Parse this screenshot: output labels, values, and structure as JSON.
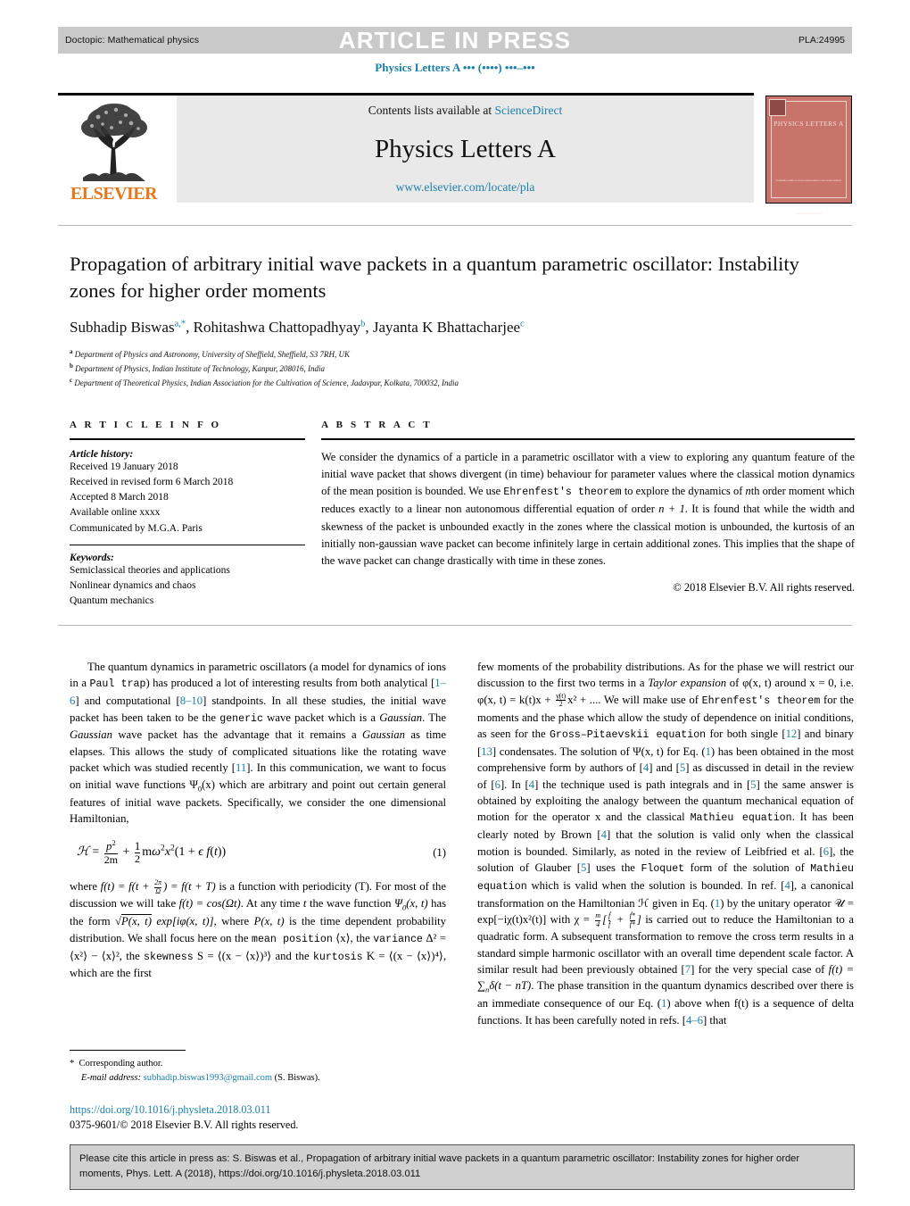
{
  "press_band": {
    "doctopic": "Doctopic: Mathematical physics",
    "title": "ARTICLE IN PRESS",
    "pla_code": "PLA:24995"
  },
  "running_head": "Physics Letters A ••• (••••) •••–•••",
  "masthead": {
    "contents_prefix": "Contents lists available at ",
    "sciencedirect": "ScienceDirect",
    "journal_name": "Physics Letters A",
    "journal_url": "www.elsevier.com/locate/pla",
    "publisher": "ELSEVIER"
  },
  "cover": {
    "title": "PHYSICS LETTERS A",
    "footer": "Available online at www.sciencedirect.com\nScienceDirect",
    "bottom": "An International Journal"
  },
  "article": {
    "title": "Propagation of arbitrary initial wave packets in a quantum parametric oscillator: Instability zones for higher order moments",
    "authors": [
      {
        "name": "Subhadip Biswas",
        "marks": "a,*"
      },
      {
        "name": "Rohitashwa Chattopadhyay",
        "marks": "b"
      },
      {
        "name": "Jayanta K Bhattacharjee",
        "marks": "c"
      }
    ],
    "affiliations": [
      {
        "mark": "a",
        "text": "Department of Physics and Astronomy, University of Sheffield, Sheffield, S3 7RH, UK"
      },
      {
        "mark": "b",
        "text": "Department of Physics, Indian Institute of Technology, Kanpur, 208016, India"
      },
      {
        "mark": "c",
        "text": "Department of Theoretical Physics, Indian Association for the Cultivation of Science, Jadavpur, Kolkata, 700032, India"
      }
    ]
  },
  "info": {
    "heading": "A R T I C L E   I N F O",
    "history_label": "Article history:",
    "history": [
      "Received 19 January 2018",
      "Received in revised form 6 March 2018",
      "Accepted 8 March 2018",
      "Available online xxxx",
      "Communicated by M.G.A. Paris"
    ],
    "keywords_label": "Keywords:",
    "keywords": [
      "Semiclassical theories and applications",
      "Nonlinear dynamics and chaos",
      "Quantum mechanics"
    ]
  },
  "abstract": {
    "heading": "A B S T R A C T",
    "part1": "We consider the dynamics of a particle in a parametric oscillator with a view to exploring any quantum feature of the initial wave packet that shows divergent (in time) behaviour for parameter values where the classical motion dynamics of the mean position is bounded. We use ",
    "mono1": "Ehrenfest's theorem",
    "part2": " to explore the dynamics of ",
    "italic_n": "n",
    "part3": "th order moment which reduces exactly to a linear non autonomous differential equation of order ",
    "order_math": "n + 1",
    "part4": ". It is found that while the width and skewness of the packet is unbounded exactly in the zones where the classical motion is unbounded, the kurtosis of an initially non-gaussian wave packet can become infinitely large in certain additional zones. This implies that the shape of the wave packet can change drastically with time in these zones.",
    "copyright": "© 2018 Elsevier B.V. All rights reserved."
  },
  "body": {
    "left": {
      "p1_a": "The quantum dynamics in parametric oscillators (a model for dynamics of ions in a ",
      "p1_mono1": "Paul trap",
      "p1_b": ") has produced a lot of interesting results from both analytical [",
      "p1_ref1": "1–6",
      "p1_c": "] and computational [",
      "p1_ref2": "8–10",
      "p1_d": "] standpoints. In all these studies, the initial wave packet has been taken to be the ",
      "p1_mono2": "generic",
      "p1_e": " wave packet which is a ",
      "p1_it1": "Gaussian",
      "p1_f": ". The ",
      "p1_it2": "Gaussian",
      "p1_g": " wave packet has the advantage that it remains a ",
      "p1_it3": "Gaussian",
      "p1_h": " as time elapses. This allows the study of complicated situations like the rotating wave packet which was studied recently [",
      "p1_ref3": "11",
      "p1_i": "]. In this communication, we want to focus on initial wave functions Ψ",
      "p1_sub": "0",
      "p1_j": "(x) which are arbitrary and point out certain general features of initial wave packets. Specifically, we consider the one dimensional Hamiltonian,",
      "eq1_number": "(1)",
      "p2_a": "where ",
      "p2_b": " is a function with periodicity (T). For most of the discussion we will take ",
      "p2_c": ". At any time ",
      "p2_d": " the wave function ",
      "p2_e": " has the form ",
      "p2_f": ", where ",
      "p2_g": " is the time dependent probability distribution. We shall focus here on the ",
      "p2_mono1": "mean position",
      "p2_h": " ⟨x⟩, the ",
      "p2_mono2": "variance",
      "p2_i": " Δ² = ⟨x²⟩ − ⟨x⟩², the ",
      "p2_mono3": "skewness",
      "p2_j": " S = ⟨(x − ⟨x⟩)³⟩ and the ",
      "p2_mono4": "kurtosis",
      "p2_k": " K = ⟨(x − ⟨x⟩)⁴⟩, which are the first"
    },
    "right": {
      "p3_a": "few moments of the probability distributions. As for the phase we will restrict our discussion to the first two terms in a ",
      "p3_it1": "Taylor expansion",
      "p3_b": " of φ(x, t) around x = 0, i.e. φ(x, t) = k(t)x + ",
      "p3_c": "x² + .... We will make use of ",
      "p3_mono1": "Ehrenfest's theorem",
      "p3_d": " for the moments and the phase which allow the study of dependence on initial conditions, as seen for the ",
      "p3_mono2": "Gross–Pitaevskii equation",
      "p3_e": " for both single [",
      "p3_ref1": "12",
      "p3_f": "] and binary [",
      "p3_ref2": "13",
      "p3_g": "] condensates. The solution of Ψ(x, t) for Eq. (",
      "p3_ref3": "1",
      "p3_h": ") has been obtained in the most comprehensive form by authors of [",
      "p3_ref4": "4",
      "p3_i": "] and [",
      "p3_ref5": "5",
      "p3_j": "] as discussed in detail in the review of [",
      "p3_ref6": "6",
      "p3_k": "]. In [",
      "p3_ref7": "4",
      "p3_l": "] the technique used is path integrals and in [",
      "p3_ref8": "5",
      "p3_m": "] the same answer is obtained by exploiting the analogy between the quantum mechanical equation of motion for the operator x and the classical ",
      "p3_mono3": "Mathieu equation",
      "p3_n": ". It has been clearly noted by Brown [",
      "p3_ref9": "4",
      "p3_o": "] that the solution is valid only when the classical motion is bounded. Similarly, as noted in the review of Leibfried et al. [",
      "p3_ref10": "6",
      "p3_p": "], the solution of Glauber [",
      "p3_ref11": "5",
      "p3_q": "] uses the ",
      "p3_mono4": "Floquet",
      "p3_r": " form of the solution of ",
      "p3_mono5": "Mathieu equation",
      "p3_s": " which is valid when the solution is bounded. In ref. [",
      "p3_ref12": "4",
      "p3_t": "], a canonical transformation on the Hamiltonian ℋ given in Eq. (",
      "p3_ref13": "1",
      "p3_u": ") by the unitary operator 𝒰 = exp[−iχ(t)x²(t)] with χ = ",
      "p3_v": " is carried out to reduce the Hamiltonian to a quadratic form. A subsequent transformation to remove the cross term results in a standard simple harmonic oscillator with an overall time dependent scale factor. A similar result had been previously obtained [",
      "p3_ref14": "7",
      "p3_w": "] for the very special case of ",
      "p3_x": ". The phase transition in the quantum dynamics described over there is an immediate consequence of our Eq. (",
      "p3_ref15": "1",
      "p3_y": ") above when f(t) is a sequence of delta functions. It has been carefully noted in refs. [",
      "p3_ref16": "4–6",
      "p3_z": "] that"
    }
  },
  "footnote": {
    "star": "*",
    "corresponding": "Corresponding author.",
    "email_label": "E-mail address:",
    "email": "subhadip.biswas1993@gmail.com",
    "email_owner": "(S. Biswas).",
    "doi": "https://doi.org/10.1016/j.physleta.2018.03.011",
    "issn": "0375-9601/© 2018 Elsevier B.V. All rights reserved."
  },
  "cite_box": {
    "text": "Please cite this article in press as: S. Biswas et al., Propagation of arbitrary initial wave packets in a quantum parametric oscillator: Instability zones for higher order moments, Phys. Lett. A (2018), https://doi.org/10.1016/j.physleta.2018.03.011"
  },
  "colors": {
    "link": "#1b7fa8",
    "elsevier_orange": "#e8761a",
    "band_grey": "#c9c9c9",
    "panel_grey": "#e9e9e9",
    "cover_red": "#c9746a",
    "cite_grey": "#d0d0d0"
  }
}
